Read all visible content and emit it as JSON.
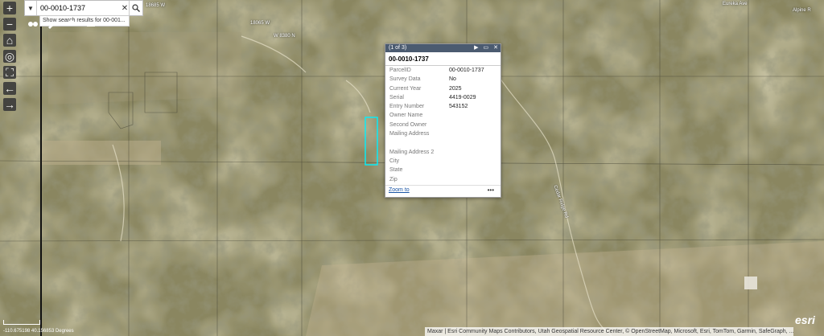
{
  "search": {
    "value": "00-0010-1737",
    "suggestion": "Show search results for 00-001..."
  },
  "map_labels": [
    "18685 W",
    "18065 W",
    "W 8380 N",
    "Eureka Ave",
    "Alpine R",
    "Cedar Ridge Rd"
  ],
  "popup": {
    "counter": "(1 of 3)",
    "title": "00-0010-1737",
    "fields": [
      {
        "label": "ParcelID",
        "value": "00-0010-1737"
      },
      {
        "label": "Survey Data",
        "value": "No"
      },
      {
        "label": "Current Year",
        "value": "2025"
      },
      {
        "label": "Serial",
        "value": "4419-0029"
      },
      {
        "label": "Entry Number",
        "value": "543152"
      },
      {
        "label": "Owner Name",
        "value": ""
      },
      {
        "label": "Second Owner",
        "value": ""
      },
      {
        "label": "Mailing Address",
        "value": ""
      },
      {
        "label": "",
        "value": ""
      },
      {
        "label": "Mailing Address 2",
        "value": ""
      },
      {
        "label": "City",
        "value": ""
      },
      {
        "label": "State",
        "value": ""
      },
      {
        "label": "Zip",
        "value": ""
      }
    ],
    "zoom_link": "Zoom to",
    "more": "•••"
  },
  "coords": "-110.675198 40.156853 Degrees",
  "attribution": "Maxar | Esri Community Maps Contributors, Utah Geospatial Resource Center, © OpenStreetMap, Microsoft, Esri, TomTom, Garmin, SafeGraph, ...",
  "logo": "esri"
}
